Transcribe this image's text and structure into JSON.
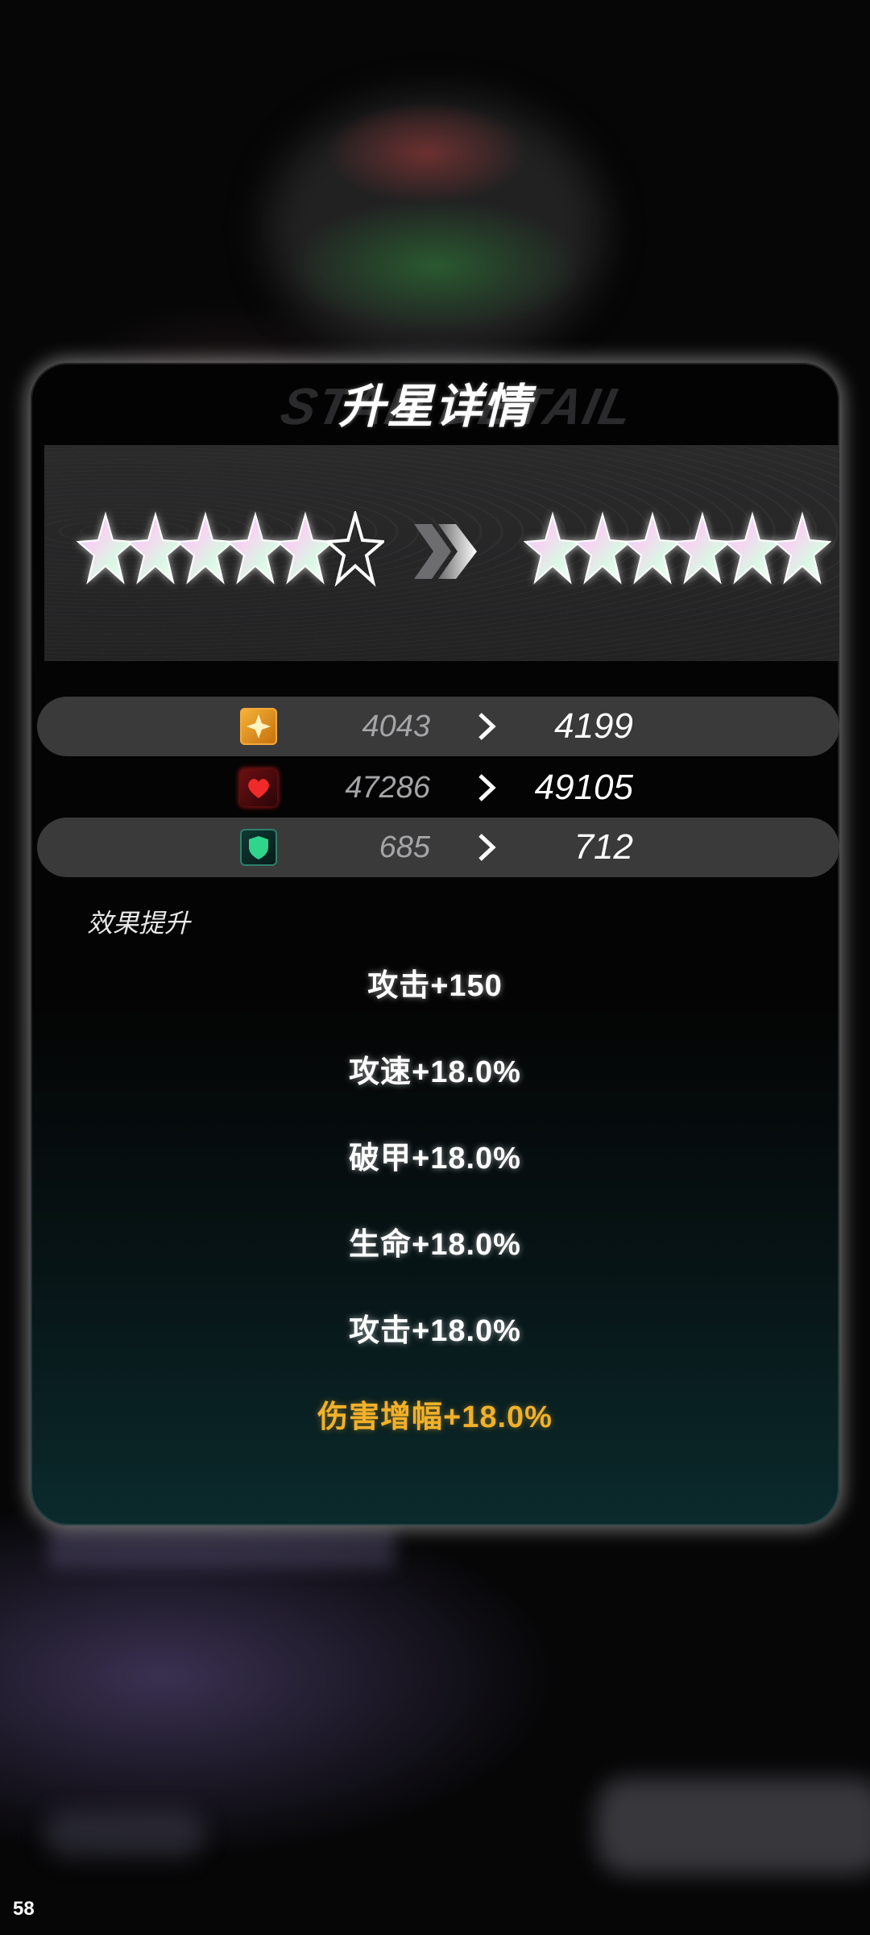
{
  "panel": {
    "title": "升星详情",
    "title_backdrop_text": "STAR DETAIL"
  },
  "stars": {
    "current_count": 5,
    "target_count": 6
  },
  "stats": [
    {
      "icon": "attack-icon",
      "old": "4043",
      "new": "4199",
      "color": "#f5a623"
    },
    {
      "icon": "health-icon",
      "old": "47286",
      "new": "49105",
      "color": "#e02424"
    },
    {
      "icon": "defense-icon",
      "old": "685",
      "new": "712",
      "color": "#2fd58a"
    }
  ],
  "effects": {
    "label": "效果提升",
    "items": [
      "攻击+150",
      "攻速+18.0%",
      "破甲+18.0%",
      "生命+18.0%",
      "攻击+18.0%",
      "伤害增幅+18.0%"
    ]
  },
  "overlay": {
    "fps": "58"
  },
  "colors": {
    "highlight": "#f2b12a",
    "panel_glow": "#ffffff"
  }
}
